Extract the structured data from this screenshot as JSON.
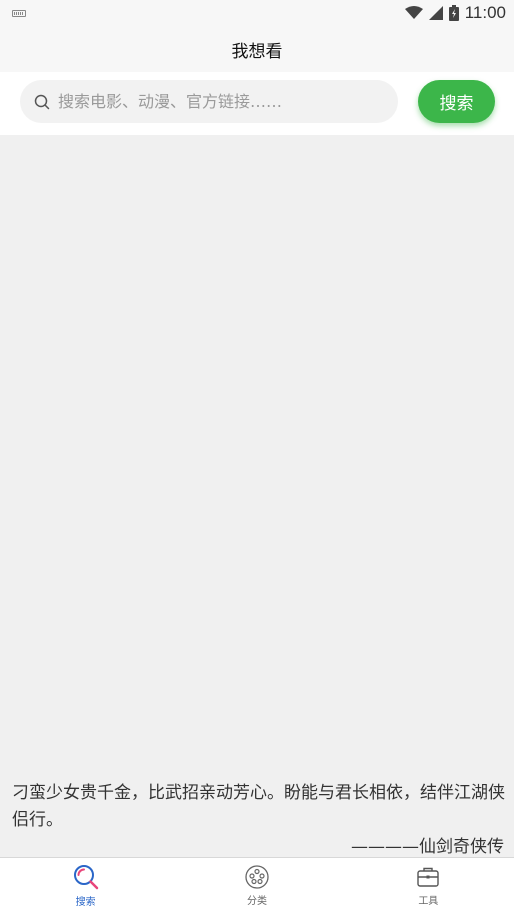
{
  "status_bar": {
    "time": "11:00"
  },
  "header": {
    "title": "我想看"
  },
  "search": {
    "placeholder": "搜索电影、动漫、官方链接……",
    "button_label": "搜索"
  },
  "quote": {
    "text": "刁蛮少女贵千金，比武招亲动芳心。盼能与君长相依，结伴江湖侠侣行。",
    "source": "————仙剑奇侠传"
  },
  "bottom_nav": {
    "items": [
      {
        "label": "搜索",
        "icon": "search-icon",
        "active": true
      },
      {
        "label": "分类",
        "icon": "film-reel-icon",
        "active": false
      },
      {
        "label": "工具",
        "icon": "toolbox-icon",
        "active": false
      }
    ]
  },
  "colors": {
    "accent_green": "#3cb64a",
    "active_blue": "#2a66c8",
    "active_pink": "#e8457a"
  }
}
